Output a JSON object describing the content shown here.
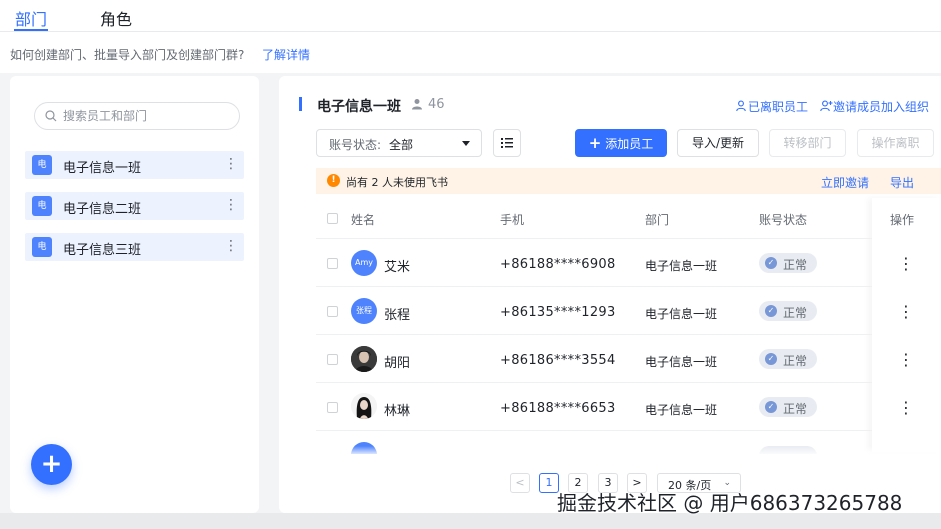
{
  "tabs": [
    {
      "label": "部门",
      "active": true
    },
    {
      "label": "角色",
      "active": false
    }
  ],
  "hint": {
    "text": "如何创建部门、批量导入部门及创建部门群?",
    "link": "了解详情"
  },
  "sidebar": {
    "search_placeholder": "搜索员工和部门",
    "departments": [
      {
        "icon_text": "电",
        "label": "电子信息一班"
      },
      {
        "icon_text": "电",
        "label": "电子信息二班"
      },
      {
        "icon_text": "电",
        "label": "电子信息三班"
      }
    ],
    "more_glyph": "⋮",
    "fab_glyph": "+"
  },
  "header": {
    "title": "电子信息一班",
    "member_count": "46",
    "resigned_link": "已离职员工",
    "invite_link": "邀请成员加入组织"
  },
  "toolbar": {
    "status_label": "账号状态:",
    "status_value": "全部",
    "add_button": "添加员工",
    "add_glyph": "+",
    "import_button": "导入/更新",
    "transfer_button": "转移部门",
    "resign_button": "操作离职"
  },
  "notice": {
    "icon_text": "!",
    "text": "尚有 2 人未使用飞书",
    "invite_link": "立即邀请",
    "export_link": "导出"
  },
  "table": {
    "columns": [
      "姓名",
      "手机",
      "部门",
      "账号状态",
      "操作"
    ],
    "rows": [
      {
        "avatar_text": "Amy",
        "avatar_type": "initials",
        "name": "艾米",
        "phone": "+86188****6908",
        "dept": "电子信息一班",
        "status": "正常"
      },
      {
        "avatar_text": "张程",
        "avatar_type": "initials",
        "name": "张程",
        "phone": "+86135****1293",
        "dept": "电子信息一班",
        "status": "正常"
      },
      {
        "avatar_text": "",
        "avatar_type": "photo",
        "name": "胡阳",
        "phone": "+86186****3554",
        "dept": "电子信息一班",
        "status": "正常"
      },
      {
        "avatar_text": "",
        "avatar_type": "photo",
        "name": "林琳",
        "phone": "+86188****6653",
        "dept": "电子信息一班",
        "status": "正常"
      }
    ],
    "status_tick": "✓",
    "more_glyph": "⋮"
  },
  "pagination": {
    "prev": "<",
    "pages": [
      "1",
      "2",
      "3"
    ],
    "current": "1",
    "next": ">",
    "page_size": "20 条/页",
    "page_size_caret": "⌄"
  },
  "watermark": "掘金技术社区 @ 用户686373265788",
  "colors": {
    "accent": "#3370ff",
    "notice_bg": "#fef3e6",
    "notice_icon": "#ff8800",
    "dept_item_bg": "#edf2ff",
    "status_tag_bg": "#e8ecf2"
  }
}
